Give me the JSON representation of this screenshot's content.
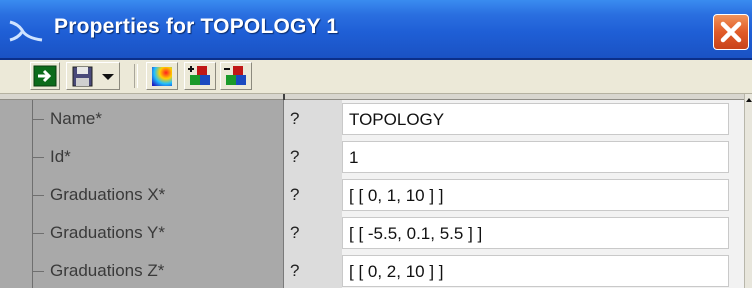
{
  "window": {
    "title": "Properties for TOPOLOGY 1"
  },
  "toolbar": {
    "buttons": [
      {
        "icon": "apply-arrow-icon"
      },
      {
        "icon": "save-icon"
      },
      {
        "icon": "dropdown-arrow-icon"
      },
      {
        "icon": "color-map-icon"
      },
      {
        "icon": "add-object-icon"
      },
      {
        "icon": "remove-object-icon"
      }
    ]
  },
  "properties": [
    {
      "label": "Name*",
      "help": "?",
      "value": "TOPOLOGY"
    },
    {
      "label": "Id*",
      "help": "?",
      "value": "1"
    },
    {
      "label": "Graduations X*",
      "help": "?",
      "value": "[ [ 0, 1, 10 ] ]"
    },
    {
      "label": "Graduations Y*",
      "help": "?",
      "value": "[ [ -5.5, 0.1, 5.5 ] ]"
    },
    {
      "label": "Graduations Z*",
      "help": "?",
      "value": "[ [ 0, 2, 10 ] ]"
    }
  ],
  "colors": {
    "titlebar": "#2a6fe0",
    "close": "#e15b28",
    "label_column": "#a9a9a9"
  }
}
